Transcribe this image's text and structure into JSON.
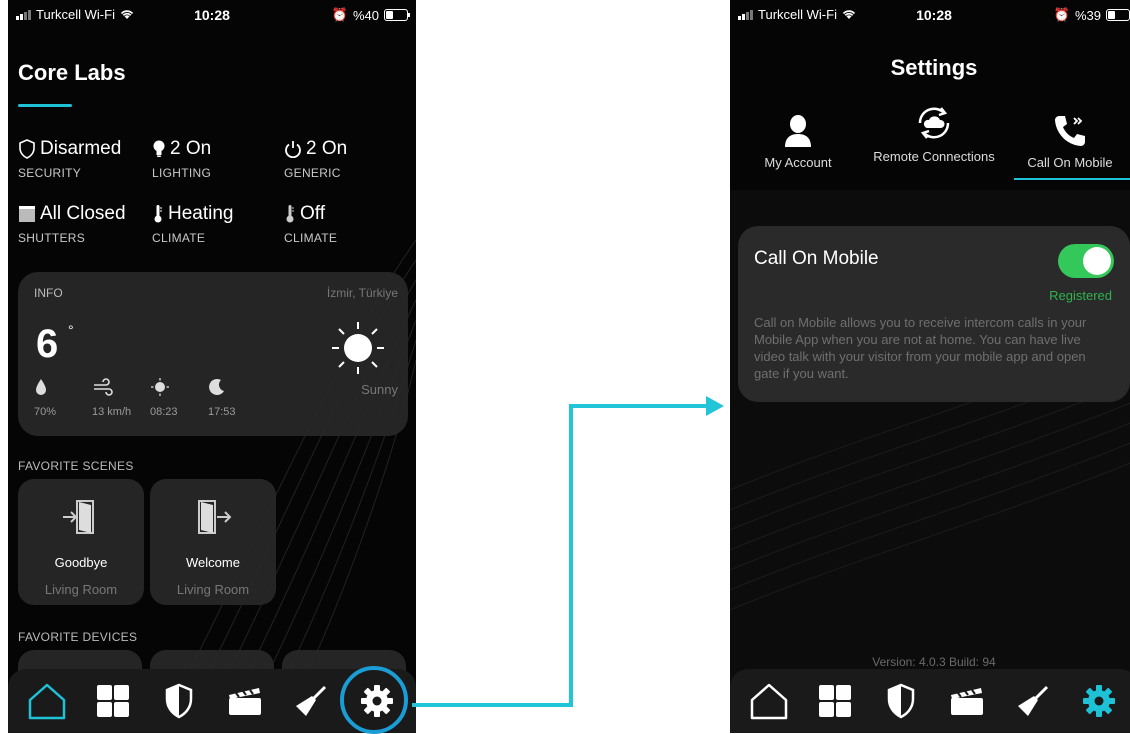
{
  "status_left": {
    "carrier": "Turkcell Wi-Fi",
    "time": "10:28",
    "battery": "%40",
    "battery_level": 0.4
  },
  "status_right": {
    "carrier": "Turkcell Wi-Fi",
    "time": "10:28",
    "battery": "%39",
    "battery_level": 0.39
  },
  "home": {
    "title": "Core Labs",
    "stats": [
      {
        "value": "Disarmed",
        "label": "SECURITY",
        "icon": "shield-outline-icon"
      },
      {
        "value": "2 On",
        "label": "LIGHTING",
        "icon": "bulb-icon"
      },
      {
        "value": "2 On",
        "label": "GENERIC",
        "icon": "power-icon"
      },
      {
        "value": "All Closed",
        "label": "SHUTTERS",
        "icon": "shutter-icon"
      },
      {
        "value": "Heating",
        "label": "CLIMATE",
        "icon": "thermometer-icon"
      },
      {
        "value": "Off",
        "label": "CLIMATE",
        "icon": "thermometer-icon"
      }
    ],
    "info": {
      "label": "INFO",
      "location": "İzmir, Türkiye",
      "temperature": "6",
      "degree": "°",
      "condition": "Sunny",
      "metrics": [
        {
          "value": "70%",
          "icon": "humidity-drop-icon"
        },
        {
          "value": "13 km/h",
          "icon": "wind-icon"
        },
        {
          "value": "08:23",
          "icon": "sunrise-icon"
        },
        {
          "value": "17:53",
          "icon": "moon-icon"
        }
      ]
    },
    "favorite_scenes_label": "FAVORITE SCENES",
    "scenes": [
      {
        "name": "Goodbye",
        "room": "Living Room",
        "icon": "door-enter-icon"
      },
      {
        "name": "Welcome",
        "room": "Living Room",
        "icon": "door-exit-icon"
      }
    ],
    "favorite_devices_label": "FAVORITE DEVICES"
  },
  "tabbar": [
    "home-icon",
    "grid-icon",
    "shield-icon",
    "clapperboard-icon",
    "broom-icon",
    "gear-icon"
  ],
  "settings": {
    "title": "Settings",
    "tabs": [
      {
        "label": "My Account",
        "icon": "person-icon"
      },
      {
        "label": "Remote Connections",
        "icon": "cloud-sync-icon"
      },
      {
        "label": "Call On Mobile",
        "icon": "phone-forward-icon",
        "active": true
      }
    ],
    "call_on_mobile": {
      "title": "Call On Mobile",
      "enabled": true,
      "status": "Registered",
      "description": "Call on Mobile allows you to receive intercom calls in your Mobile App when you are not at home. You can have live video talk with your visitor from your mobile app and open gate if you want."
    },
    "version": "Version: 4.0.3 Build: 94"
  },
  "colors": {
    "accent": "#1ec1d6",
    "ring": "#1a9cd4",
    "toggle": "#34c759",
    "registered": "#2fb14d",
    "connector": "#22c4d8"
  }
}
